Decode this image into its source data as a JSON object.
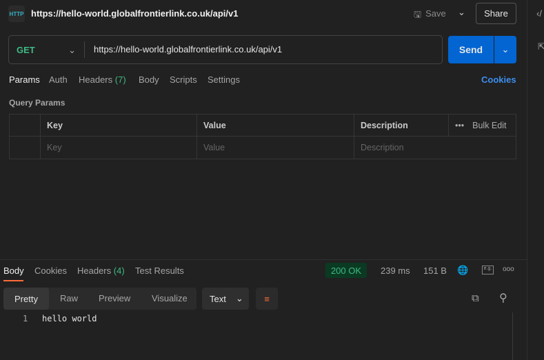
{
  "header": {
    "title": "https://hello-world.globalfrontierlink.co.uk/api/v1",
    "save_label": "Save",
    "share_label": "Share",
    "icon": "http-icon"
  },
  "request": {
    "method": "GET",
    "url": "https://hello-world.globalfrontierlink.co.uk/api/v1",
    "send_label": "Send"
  },
  "request_tabs": [
    {
      "label": "Params"
    },
    {
      "label": "Auth"
    },
    {
      "label": "Headers",
      "count": "(7)"
    },
    {
      "label": "Body"
    },
    {
      "label": "Scripts"
    },
    {
      "label": "Settings"
    }
  ],
  "cookies_label": "Cookies",
  "query_params": {
    "title": "Query Params",
    "columns": [
      "Key",
      "Value",
      "Description"
    ],
    "bulk_edit": "Bulk Edit",
    "placeholders": {
      "key": "Key",
      "value": "Value",
      "description": "Description"
    }
  },
  "response_tabs": [
    {
      "label": "Body"
    },
    {
      "label": "Cookies"
    },
    {
      "label": "Headers",
      "count": "(4)"
    },
    {
      "label": "Test Results"
    }
  ],
  "status": {
    "code": "200 OK",
    "time": "239 ms",
    "size": "151 B"
  },
  "view_modes": [
    "Pretty",
    "Raw",
    "Preview",
    "Visualize"
  ],
  "format": "Text",
  "body": {
    "lines": [
      {
        "n": "1",
        "text": "hello world"
      }
    ]
  },
  "colors": {
    "accent": "#0265d2",
    "method": "#3fba85",
    "tab_underline": "#ff6c37",
    "link": "#3d8ff0"
  }
}
